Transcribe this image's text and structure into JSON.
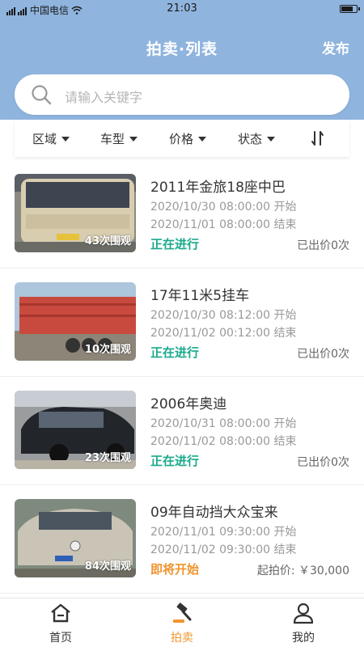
{
  "status_bar": {
    "carrier": "中国电信",
    "time": "21:03"
  },
  "header": {
    "title": "拍卖·列表",
    "publish_label": "发布"
  },
  "search": {
    "placeholder": "请输入关键字"
  },
  "filters": [
    {
      "label": "区域"
    },
    {
      "label": "车型"
    },
    {
      "label": "价格"
    },
    {
      "label": "状态"
    }
  ],
  "items": [
    {
      "title": "2011年金旅18座中巴",
      "start": "2020/10/30 08:00:00 开始",
      "end": "2020/11/01 08:00:00 结束",
      "status": "正在进行",
      "bid": "已出价0次",
      "views": "43次围观"
    },
    {
      "title": "17年11米5挂车",
      "start": "2020/10/30 08:12:00 开始",
      "end": "2020/11/02 00:12:00 结束",
      "status": "正在进行",
      "bid": "已出价0次",
      "views": "10次围观"
    },
    {
      "title": "2006年奥迪",
      "start": "2020/10/31 08:00:00 开始",
      "end": "2020/11/02 08:00:00 结束",
      "status": "正在进行",
      "bid": "已出价0次",
      "views": "23次围观"
    },
    {
      "title": "09年自动挡大众宝来",
      "start": "2020/11/01 09:30:00 开始",
      "end": "2020/11/02 09:30:00 结束",
      "status": "即将开始",
      "bid": "起拍价: ￥30,000",
      "views": "84次围观"
    }
  ],
  "tabs": [
    {
      "label": "首页"
    },
    {
      "label": "拍卖"
    },
    {
      "label": "我的"
    }
  ],
  "colors": {
    "header": "#8fb4de",
    "ongoing": "#1aaa8b",
    "upcoming": "#f0952e",
    "active_tab": "#f0952e"
  }
}
